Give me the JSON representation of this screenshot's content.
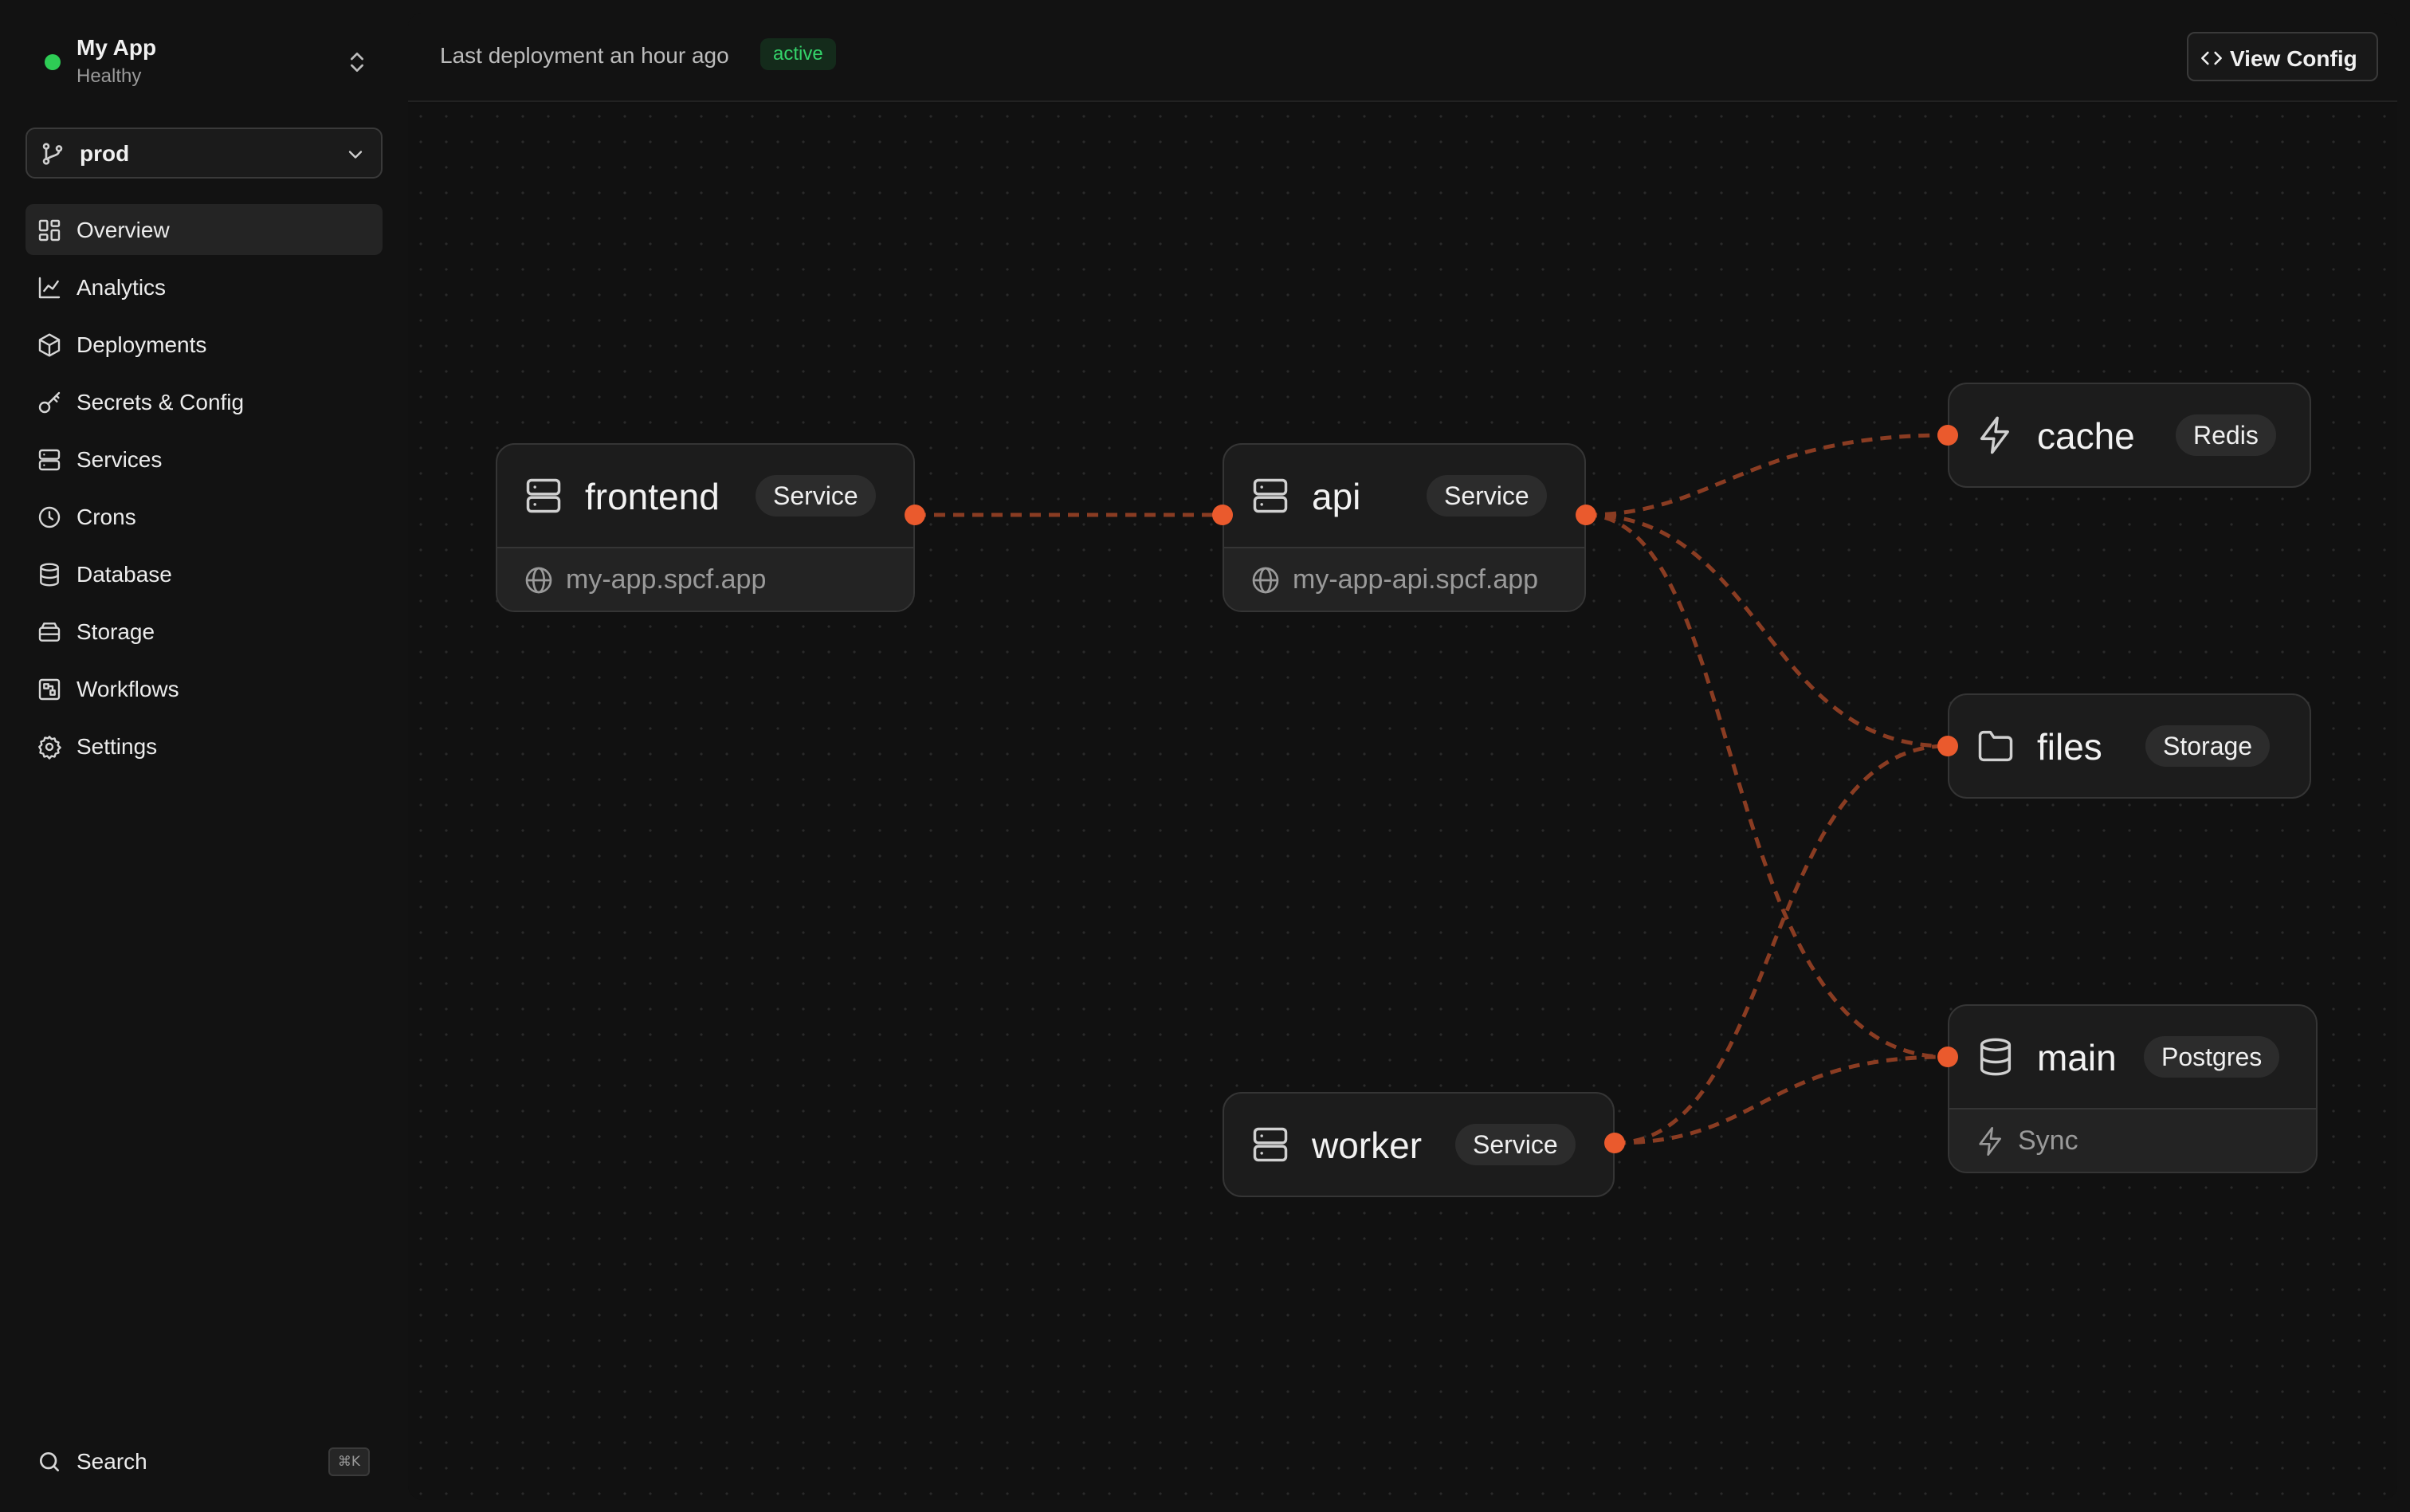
{
  "app": {
    "name": "My App",
    "status": "Healthy"
  },
  "branch": {
    "label": "prod"
  },
  "nav": [
    {
      "label": "Overview",
      "icon": "dashboard-icon",
      "active": true
    },
    {
      "label": "Analytics",
      "icon": "chart-icon"
    },
    {
      "label": "Deployments",
      "icon": "box-icon"
    },
    {
      "label": "Secrets & Config",
      "icon": "key-icon"
    },
    {
      "label": "Services",
      "icon": "server-icon"
    },
    {
      "label": "Crons",
      "icon": "clock-icon"
    },
    {
      "label": "Database",
      "icon": "database-icon"
    },
    {
      "label": "Storage",
      "icon": "hard-drive-icon"
    },
    {
      "label": "Workflows",
      "icon": "workflow-icon"
    },
    {
      "label": "Settings",
      "icon": "gear-icon"
    }
  ],
  "search": {
    "label": "Search",
    "shortcut": "⌘K"
  },
  "header": {
    "deployment_text": "Last deployment an hour ago",
    "status_badge": "active",
    "view_config_label": "View Config"
  },
  "graph": {
    "nodes": {
      "frontend": {
        "name": "frontend",
        "type": "Service",
        "url": "my-app.spcf.app",
        "icon": "server-icon"
      },
      "api": {
        "name": "api",
        "type": "Service",
        "url": "my-app-api.spcf.app",
        "icon": "server-icon"
      },
      "worker": {
        "name": "worker",
        "type": "Service",
        "icon": "server-icon"
      },
      "cache": {
        "name": "cache",
        "type": "Redis",
        "icon": "zap-icon"
      },
      "files": {
        "name": "files",
        "type": "Storage",
        "icon": "folder-icon"
      },
      "main": {
        "name": "main",
        "type": "Postgres",
        "footer": "Sync",
        "icon": "database-icon"
      }
    },
    "edges": [
      [
        "frontend",
        "api"
      ],
      [
        "api",
        "cache"
      ],
      [
        "api",
        "files"
      ],
      [
        "api",
        "main"
      ],
      [
        "worker",
        "files"
      ],
      [
        "worker",
        "main"
      ]
    ]
  },
  "colors": {
    "accent": "#ea5a2d",
    "edge": "#8a3c22",
    "healthy": "#2ecc55",
    "active_badge_text": "#34d36a"
  }
}
